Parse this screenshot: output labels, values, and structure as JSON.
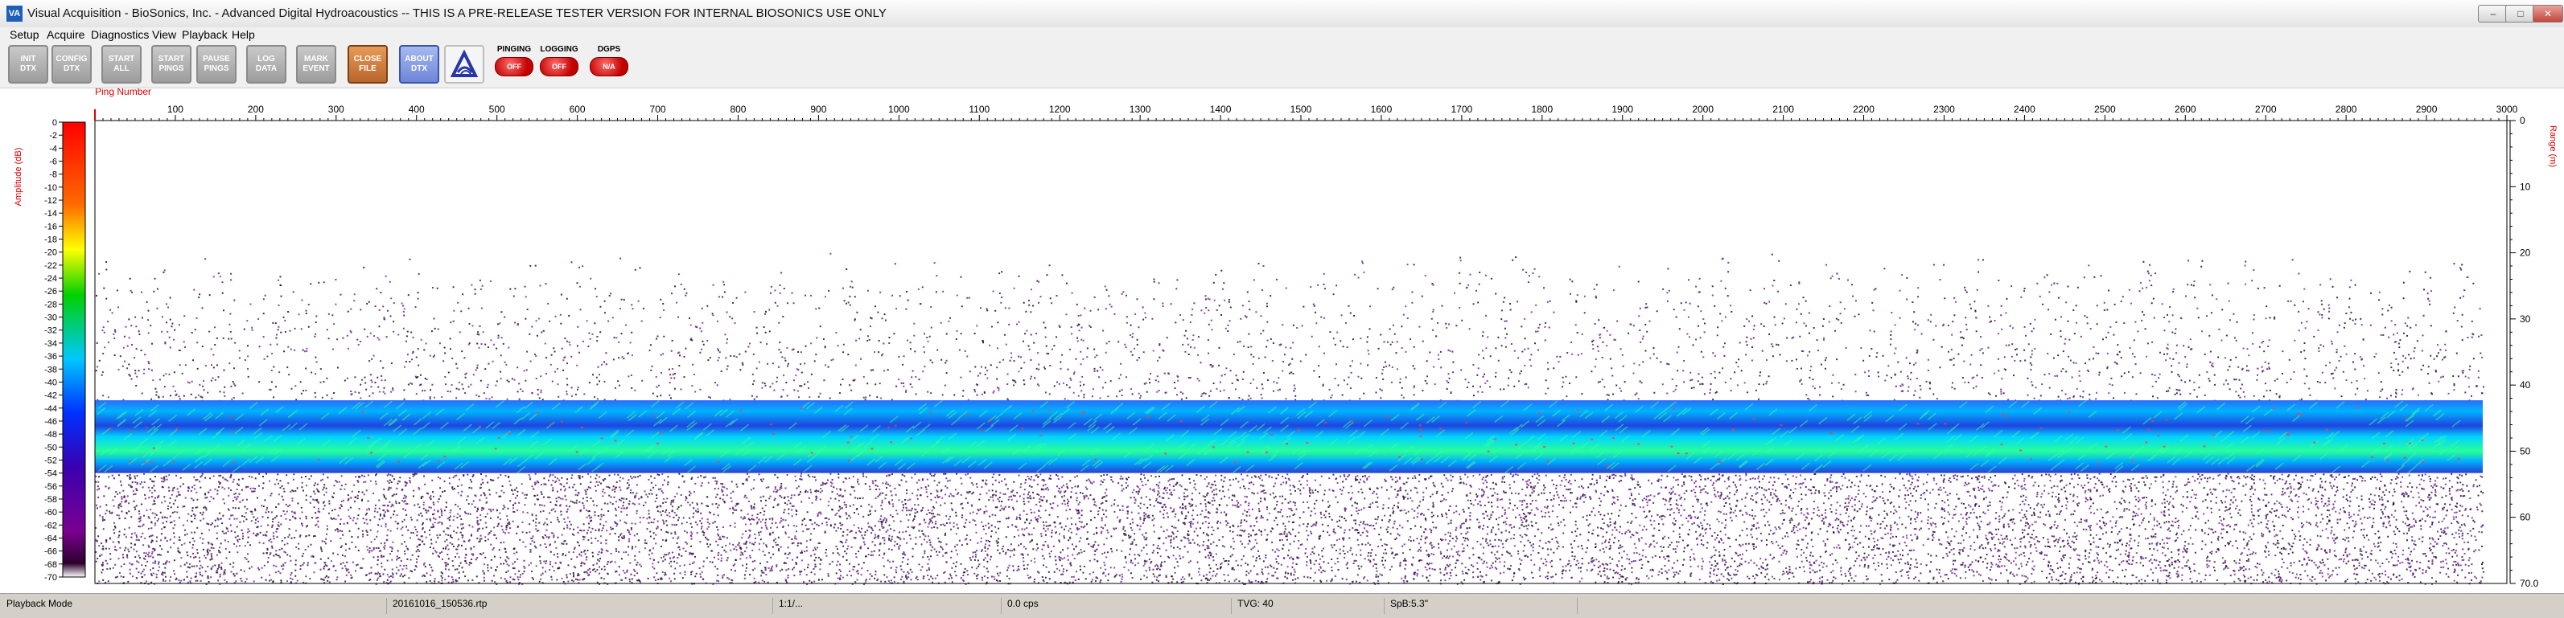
{
  "window": {
    "title": "Visual Acquisition  -  BioSonics, Inc.  -  Advanced Digital Hydroacoustics  -- THIS IS A PRE-RELEASE TESTER VERSION FOR INTERNAL BIOSONICS USE ONLY",
    "app_icon_text": "VA",
    "controls": {
      "minimize": "–",
      "maximize": "□",
      "close": "✕"
    }
  },
  "menu": [
    "Setup",
    "Acquire",
    "Diagnostics",
    "View",
    "Playback",
    "Help"
  ],
  "toolbar": {
    "buttons": [
      {
        "label": "INIT\nDTX",
        "style": "gray"
      },
      {
        "label": "CONFIG\nDTX",
        "style": "gray"
      },
      {
        "label": "START\nALL",
        "style": "gray"
      },
      {
        "label": "START\nPINGS",
        "style": "gray"
      },
      {
        "label": "PAUSE\nPINGS",
        "style": "gray"
      },
      {
        "label": "LOG\nDATA",
        "style": "gray"
      },
      {
        "label": "MARK\nEVENT",
        "style": "gray"
      },
      {
        "label": "CLOSE\nFILE",
        "style": "orange"
      },
      {
        "label": "ABOUT\nDTX",
        "style": "blue"
      }
    ],
    "logo_icon": "biosonics-logo-icon",
    "indicators": [
      {
        "title": "PINGING",
        "state": "OFF"
      },
      {
        "title": "LOGGING",
        "state": "OFF"
      },
      {
        "title": "DGPS",
        "state": "N/A"
      }
    ]
  },
  "echogram": {
    "x_axis_title": "Ping Number",
    "x_ticks": [
      100,
      200,
      300,
      400,
      500,
      600,
      700,
      800,
      900,
      1000,
      1100,
      1200,
      1300,
      1400,
      1500,
      1600,
      1700,
      1800,
      1900,
      2000,
      2100,
      2200,
      2300,
      2400,
      2500,
      2600,
      2700,
      2800,
      2900,
      3000
    ],
    "x_range": [
      0,
      3000
    ],
    "left_axis_title": "Amplitude (dB)",
    "right_axis_title": "Range (m)",
    "amplitude_ticks": [
      0,
      -2,
      -4,
      -6,
      -8,
      -10,
      -12,
      -14,
      -16,
      -18,
      -20,
      -22,
      -24,
      -26,
      -28,
      -30,
      -32,
      -34,
      -36,
      -38,
      -40,
      -42,
      -44,
      -46,
      -48,
      -50,
      -52,
      -54,
      -56,
      -58,
      -60,
      -62,
      -64,
      -66,
      -68,
      -70
    ],
    "amplitude_range": [
      0,
      -70
    ],
    "range_ticks": [
      "0",
      "10",
      "20",
      "30",
      "40",
      "50",
      "60",
      "70.0"
    ],
    "range_max": 70,
    "colors": {
      "axis_label": "#e00000",
      "scale": [
        "#ff0000",
        "#ff8000",
        "#ffff00",
        "#00d000",
        "#00c0ff",
        "#0040ff",
        "#3000c0",
        "#800090",
        "#ffffff"
      ]
    }
  },
  "status_bar": {
    "mode": "Playback Mode",
    "file": "20161016_150536.rtp",
    "ratio": "1:1/...",
    "rate": "0.0 cps",
    "tvg": "TVG: 40",
    "spb": "SpB:5.3\""
  }
}
